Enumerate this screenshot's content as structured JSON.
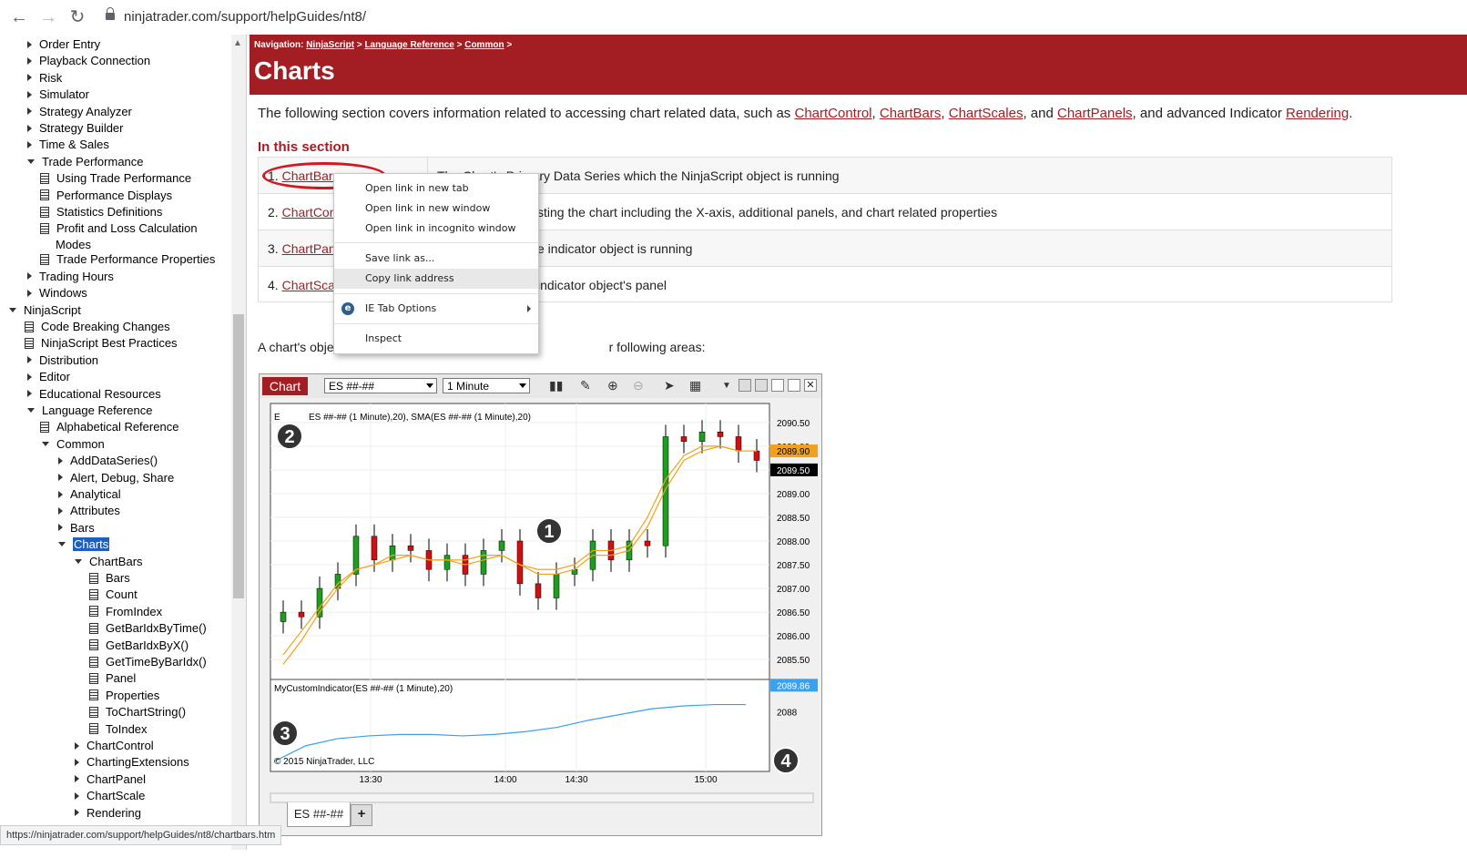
{
  "browser": {
    "url": "ninjatrader.com/support/helpGuides/nt8/",
    "status_url": "https://ninjatrader.com/support/helpGuides/nt8/chartbars.htm"
  },
  "sidebar": {
    "items": [
      {
        "label": "Order Entry",
        "kind": "collapsed",
        "level": 1
      },
      {
        "label": "Playback Connection",
        "kind": "collapsed",
        "level": 1
      },
      {
        "label": "Risk",
        "kind": "collapsed",
        "level": 1
      },
      {
        "label": "Simulator",
        "kind": "collapsed",
        "level": 1
      },
      {
        "label": "Strategy Analyzer",
        "kind": "collapsed",
        "level": 1
      },
      {
        "label": "Strategy Builder",
        "kind": "collapsed",
        "level": 1
      },
      {
        "label": "Time & Sales",
        "kind": "collapsed",
        "level": 1
      },
      {
        "label": "Trade Performance",
        "kind": "expanded",
        "level": 1
      },
      {
        "label": "Using Trade Performance",
        "kind": "doc",
        "level": 2
      },
      {
        "label": "Performance Displays",
        "kind": "doc",
        "level": 2
      },
      {
        "label": "Statistics Definitions",
        "kind": "doc",
        "level": 2
      },
      {
        "label": "Profit and Loss Calculation",
        "label2": "Modes",
        "kind": "doc",
        "level": 2
      },
      {
        "label": "Trade Performance Properties",
        "kind": "doc",
        "level": 2
      },
      {
        "label": "Trading Hours",
        "kind": "collapsed",
        "level": 1
      },
      {
        "label": "Windows",
        "kind": "collapsed",
        "level": 1
      },
      {
        "label": "NinjaScript",
        "kind": "expanded",
        "level": 0
      },
      {
        "label": "Code Breaking Changes",
        "kind": "doc",
        "level": 1
      },
      {
        "label": "NinjaScript Best Practices",
        "kind": "doc",
        "level": 1
      },
      {
        "label": "Distribution",
        "kind": "collapsed",
        "level": 1
      },
      {
        "label": "Editor",
        "kind": "collapsed",
        "level": 1
      },
      {
        "label": "Educational Resources",
        "kind": "collapsed",
        "level": 1
      },
      {
        "label": "Language Reference",
        "kind": "expanded",
        "level": 1
      },
      {
        "label": "Alphabetical Reference",
        "kind": "doc",
        "level": 2
      },
      {
        "label": "Common",
        "kind": "expanded",
        "level": 2
      },
      {
        "label": "AddDataSeries()",
        "kind": "collapsed",
        "level": 3
      },
      {
        "label": "Alert, Debug, Share",
        "kind": "collapsed",
        "level": 3
      },
      {
        "label": "Analytical",
        "kind": "collapsed",
        "level": 3
      },
      {
        "label": "Attributes",
        "kind": "collapsed",
        "level": 3
      },
      {
        "label": "Bars",
        "kind": "collapsed",
        "level": 3
      },
      {
        "label": "Charts",
        "kind": "expanded",
        "level": 3,
        "selected": true
      },
      {
        "label": "ChartBars",
        "kind": "expanded",
        "level": 4
      },
      {
        "label": "Bars",
        "kind": "doc",
        "level": 5
      },
      {
        "label": "Count",
        "kind": "doc",
        "level": 5
      },
      {
        "label": "FromIndex",
        "kind": "doc",
        "level": 5
      },
      {
        "label": "GetBarIdxByTime()",
        "kind": "doc",
        "level": 5
      },
      {
        "label": "GetBarIdxByX()",
        "kind": "doc",
        "level": 5
      },
      {
        "label": "GetTimeByBarIdx()",
        "kind": "doc",
        "level": 5
      },
      {
        "label": "Panel",
        "kind": "doc",
        "level": 5
      },
      {
        "label": "Properties",
        "kind": "doc",
        "level": 5
      },
      {
        "label": "ToChartString()",
        "kind": "doc",
        "level": 5
      },
      {
        "label": "ToIndex",
        "kind": "doc",
        "level": 5
      },
      {
        "label": "ChartControl",
        "kind": "collapsed",
        "level": 4
      },
      {
        "label": "ChartingExtensions",
        "kind": "collapsed",
        "level": 4
      },
      {
        "label": "ChartPanel",
        "kind": "collapsed",
        "level": 4
      },
      {
        "label": "ChartScale",
        "kind": "collapsed",
        "level": 4
      },
      {
        "label": "Rendering",
        "kind": "collapsed",
        "level": 4
      }
    ]
  },
  "header": {
    "nav_label": "Navigation:",
    "crumbs": [
      "NinjaScript",
      "Language Reference",
      "Common"
    ],
    "sep": ">",
    "title": "Charts"
  },
  "content": {
    "intro_pre": "The following section covers information related to accessing chart related data, such as",
    "intro_links": [
      "ChartControl",
      "ChartBars",
      "ChartScales",
      "ChartPanels"
    ],
    "intro_and": ", and",
    "intro_mid": ", and advanced Indicator",
    "intro_last_link": "Rendering",
    "intro_end": ".",
    "section_head": "In this section",
    "rows": [
      {
        "num": "1.",
        "link": "ChartBars",
        "desc": "The Chart's Primary Data Series which the NinjaScript object is running"
      },
      {
        "num": "2.",
        "link": "ChartCon",
        "desc": "sting the chart including the X-axis, additional panels, and chart related properties"
      },
      {
        "num": "3.",
        "link": "ChartPan",
        "desc": "e indicator object is running"
      },
      {
        "num": "4.",
        "link": "ChartSca",
        "desc": "indicator object's panel"
      }
    ],
    "after_table_pre": "A chart's obje",
    "after_table_post": "r following areas:"
  },
  "context_menu": {
    "items": [
      "Open link in new tab",
      "Open link in new window",
      "Open link in incognito window",
      "Save link as...",
      "Copy link address",
      "IE Tab Options",
      "Inspect"
    ],
    "highlighted": "Copy link address"
  },
  "chart": {
    "tab_label": "Chart",
    "instrument": "ES ##-##",
    "interval": "1 Minute",
    "bottom_tab": "ES ##-##",
    "plus": "+",
    "price_label": "ES ##-## (1 Minute),20), SMA(ES ##-## (1 Minute),20)",
    "price_label_prefix": "E",
    "indicator_label": "MyCustomIndicator(ES ##-## (1 Minute),20)",
    "copyright": "© 2015 NinjaTrader, LLC",
    "markers": [
      "1",
      "2",
      "3",
      "4"
    ],
    "colors": {
      "up": "#1e9e1e",
      "down": "#d01010",
      "ema": "#f2a21a",
      "indicator": "#3aa0f0",
      "last_price_box": "#f2a21a"
    },
    "current_price": "2089.90",
    "last_price": "2089.50",
    "indicator_value": "2089.86",
    "indicator_axis_label": "2088"
  },
  "chart_data": {
    "type": "line",
    "title": "",
    "y_ticks": [
      "2090.50",
      "2090.00",
      "2089.50",
      "2089.00",
      "2088.50",
      "2088.00",
      "2087.50",
      "2087.00",
      "2086.50",
      "2086.00",
      "2085.50"
    ],
    "x_ticks": [
      "13:30",
      "14:00",
      "14:30",
      "15:00"
    ],
    "ylim": [
      2085.1,
      2090.9
    ],
    "series": [
      {
        "values": [
          2086.5,
          2086.4,
          2087.0,
          2087.3,
          2088.1,
          2087.6,
          2087.9,
          2087.8,
          2087.4,
          2087.7,
          2087.3,
          2087.8,
          2088.0,
          2087.1,
          2086.8,
          2087.3,
          2087.4,
          2088.0,
          2087.6,
          2088.0,
          2087.9,
          2090.2,
          2090.1,
          2090.3,
          2090.2,
          2089.9,
          2089.7
        ]
      },
      {
        "values": [
          2085.4,
          2085.9,
          2086.5,
          2087.0,
          2087.4,
          2087.5,
          2087.6,
          2087.7,
          2087.6,
          2087.6,
          2087.5,
          2087.6,
          2087.7,
          2087.5,
          2087.3,
          2087.3,
          2087.4,
          2087.7,
          2087.7,
          2087.8,
          2088.3,
          2089.1,
          2089.7,
          2089.9,
          2090.0,
          2089.9,
          2089.9
        ]
      },
      {
        "values": [
          2085.6,
          2086.1,
          2086.6,
          2087.1,
          2087.4,
          2087.5,
          2087.7,
          2087.7,
          2087.6,
          2087.6,
          2087.6,
          2087.7,
          2087.7,
          2087.5,
          2087.4,
          2087.4,
          2087.5,
          2087.8,
          2087.8,
          2087.9,
          2088.5,
          2089.3,
          2089.8,
          2090.0,
          2090.0,
          2089.9,
          2089.9
        ]
      }
    ],
    "indicator_series": {
      "values": [
        2084.5,
        2085.6,
        2086.1,
        2086.3,
        2086.4,
        2086.4,
        2086.3,
        2086.4,
        2086.6,
        2086.9,
        2087.4,
        2087.8,
        2088.2,
        2088.4,
        2088.5,
        2088.5
      ]
    }
  }
}
